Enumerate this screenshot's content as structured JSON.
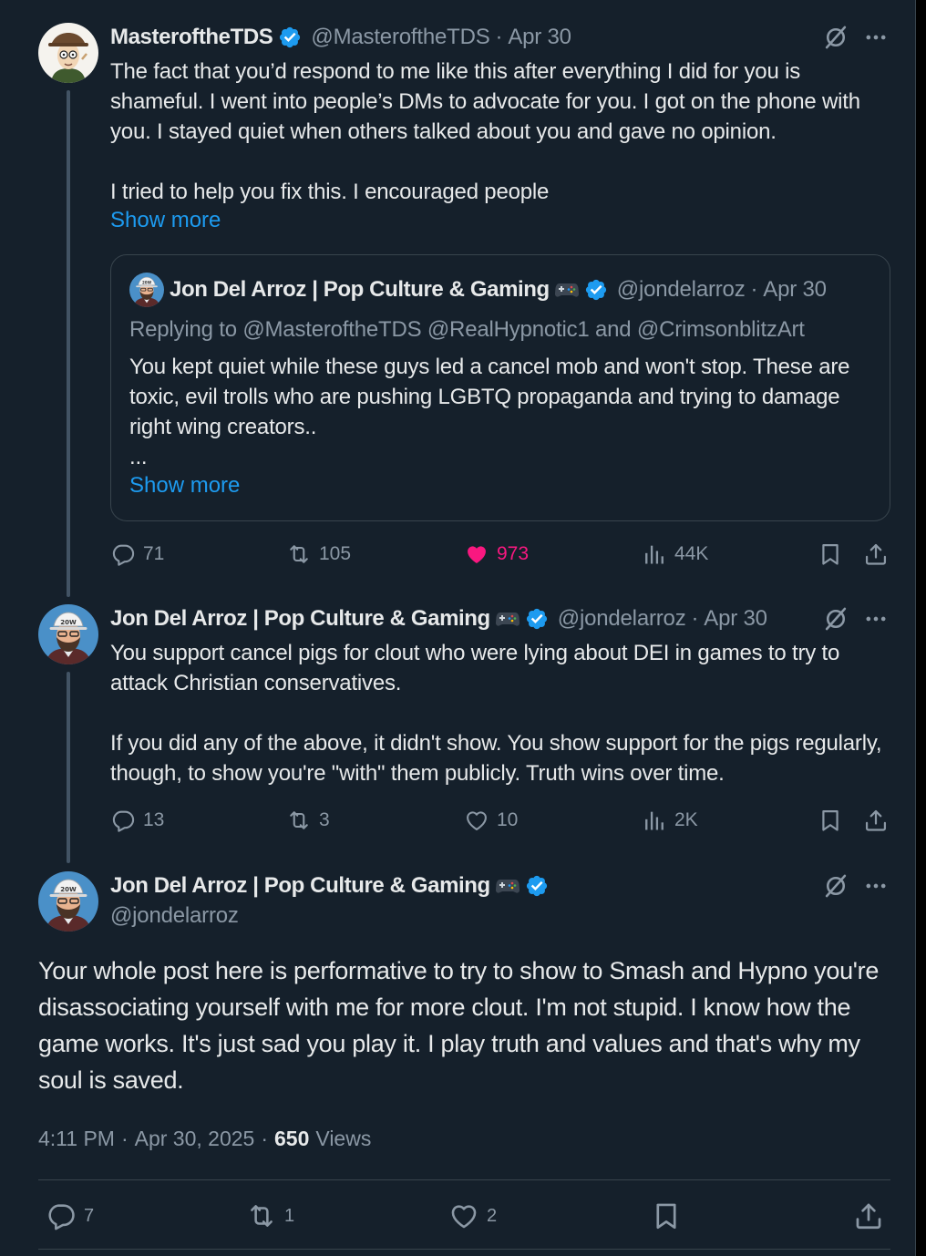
{
  "colors": {
    "background": "#15202b",
    "text": "#e7e9ea",
    "muted": "#8b98a5",
    "accent": "#1d9bf0",
    "like": "#f91880",
    "border": "#38444d"
  },
  "tweet1": {
    "name": "MasteroftheTDS",
    "handle": "@MasteroftheTDS",
    "sep": "·",
    "date": "Apr 30",
    "text": "The fact that you’d respond to me like this after everything I did for you is shameful. I went into people’s DMs to advocate for you. I got on the phone with you. I stayed quiet when others talked about you and gave no opinion.\n\nI tried to help you fix this. I encouraged people",
    "show_more": "Show more",
    "quote": {
      "name": "Jon Del Arroz | Pop Culture & Gaming",
      "handle": "@jondelarroz",
      "sep": "·",
      "date": "Apr 30",
      "replying": "Replying to @MasteroftheTDS @RealHypnotic1 and @CrimsonblitzArt",
      "text": "You kept quiet while these guys led a cancel mob and won't stop. These are toxic, evil trolls who are pushing LGBTQ propaganda and trying to damage right wing creators..\n...",
      "show_more": "Show more"
    },
    "replies": "71",
    "reposts": "105",
    "likes": "973",
    "views": "44K"
  },
  "tweet2": {
    "name": "Jon Del Arroz | Pop Culture & Gaming",
    "handle": "@jondelarroz",
    "sep": "·",
    "date": "Apr 30",
    "text": "You support cancel pigs for clout who were lying about DEI in games to try to attack Christian conservatives.\n\nIf you did any of the above, it didn't show. You show support for the pigs regularly, though, to show you're \"with\" them publicly. Truth wins over time.",
    "replies": "13",
    "reposts": "3",
    "likes": "10",
    "views": "2K"
  },
  "main": {
    "name": "Jon Del Arroz | Pop Culture & Gaming",
    "handle": "@jondelarroz",
    "text": "Your whole post here is performative to try to show to Smash and Hypno you're disassociating yourself with me for more clout. I'm not stupid. I know how the game works. It's just sad you play it. I play truth and values and that's why my soul is saved.",
    "time": "4:11 PM",
    "sep1": "·",
    "date": "Apr 30, 2025",
    "sep2": "·",
    "views_count": "650",
    "views_label": "Views",
    "replies": "7",
    "reposts": "1",
    "likes": "2"
  },
  "icons": [
    "verified-icon",
    "gamepad-icon",
    "grok-icon",
    "more-icon",
    "reply-icon",
    "repost-icon",
    "like-icon",
    "views-icon",
    "bookmark-icon",
    "share-icon"
  ]
}
